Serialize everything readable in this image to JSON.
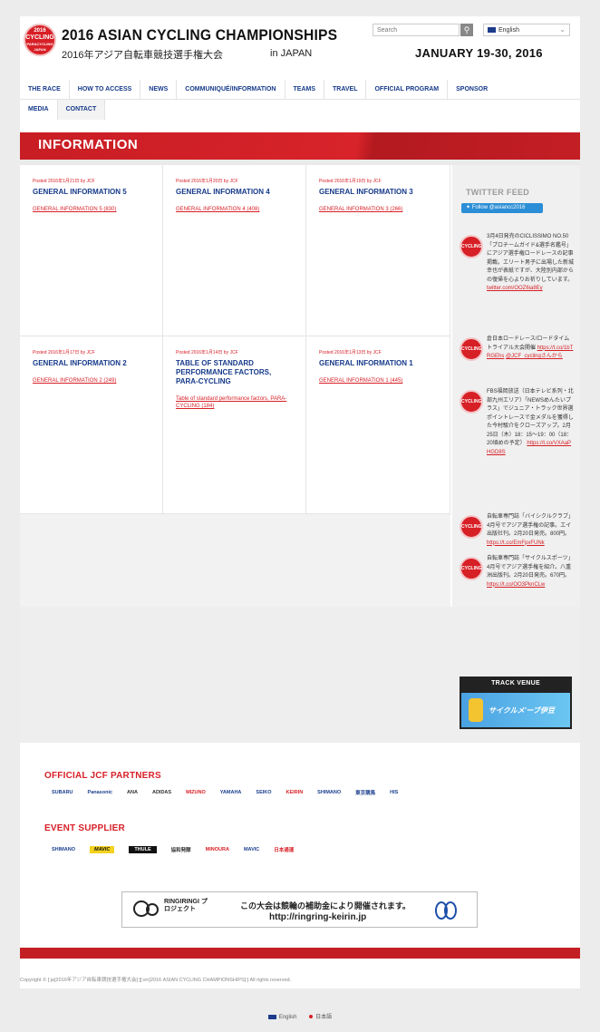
{
  "header": {
    "logo_lines": [
      "2016",
      "ASIAN",
      "CYCLING",
      "PARACYCLING",
      "JAPAN"
    ],
    "title_en": "2016 ASIAN CYCLING CHAMPIONSHIPS",
    "title_jp": "2016年アジア自転車競技選手権大会",
    "title_loc": "in JAPAN",
    "search_placeholder": "Search",
    "search_icon": "search-icon",
    "language": "English",
    "dates": "JANUARY 19-30, 2016"
  },
  "nav": {
    "row1": [
      "THE RACE",
      "HOW TO ACCESS",
      "NEWS",
      "COMMUNIQUÉ/INFORMATION",
      "TEAMS",
      "TRAVEL",
      "OFFICIAL PROGRAM",
      "SPONSOR"
    ],
    "row2": [
      "MEDIA",
      "CONTACT"
    ]
  },
  "banner": {
    "title": "INFORMATION"
  },
  "posts": [
    {
      "meta": "Posted 2016年1月21日 by JCF",
      "title": "GENERAL INFORMATION 5",
      "link": "GENERAL INFORMATION 5 (830)"
    },
    {
      "meta": "Posted 2016年1月20日 by JCF",
      "title": "GENERAL INFORMATION 4",
      "link": "GENERAL INFORMATION 4 (408)"
    },
    {
      "meta": "Posted 2016年1月19日 by JCF",
      "title": "GENERAL INFORMATION 3",
      "link": "GENERAL INFORMATION 3 (266)"
    },
    {
      "meta": "Posted 2016年1月17日 by JCF",
      "title": "GENERAL INFORMATION 2",
      "link": "GENERAL INFORMATION 2 (249)"
    },
    {
      "meta": "Posted 2016年1月14日 by JCF",
      "title": "TABLE OF STANDARD PERFORMANCE FACTORS, PARA-CYCLING",
      "link": "Table of standard performance factors, PARA-CYCLING (184)"
    },
    {
      "meta": "Posted 2016年1月13日 by JCF",
      "title": "GENERAL INFORMATION 1",
      "link": "GENERAL INFORMATION 1 (445)"
    }
  ],
  "twitter": {
    "heading": "TWITTER FEED",
    "follow": "Follow @asiancc2016",
    "avatar_text": "CYCLING",
    "tweets": [
      {
        "text": "3月4日発売のCICLISSIMO NO.50「プロチームガイド&選手名鑑号」にアジア選手権ロードレースの記事掲載。エリート男子に出場した新城幸也が表紙ですが、大陸別内部からの復帰を心よりお祈りしています。",
        "link": "twitter.com/OOZ6ia8Ey"
      },
      {
        "text": "倉日本ロードレース/ロードタイムトライアル大会開催",
        "link": "https://t.co/1bTRGEhs",
        "extra": "@JCF_cyclingさんから"
      },
      {
        "text": "FBS福岡放送（日本テレビ系列・北部九州エリア）「NEWSめんたいプラス」でジュニア・トラック世界選ポイントレースで金メダルを獲得した今村駿介をクローズアップ。2月25日（木）18：15〜19：00（18：20頃めの予定）",
        "link": "https://t.co/VXAaPHGD8S"
      },
      {
        "text": "自転車専門誌「バイシクルクラブ」4月号でアジア選手権の記事。エイ出版社刊。2月20日発売。800円。",
        "link": "https://t.co/EmFpxFUNk"
      },
      {
        "text": "自転車専門誌「サイクルスポーツ」4月号でアジア選手権を紹介。八重洲出版刊。2月20日発売。670円。",
        "link": "https://t.co/OO3PknCLw"
      }
    ]
  },
  "track_venue": {
    "label": "TRACK VENUE",
    "image_text": "サイクルメ'ーブ伊豆"
  },
  "partners": {
    "heading": "OFFICIAL JCF PARTNERS",
    "logos": [
      "SUBARU",
      "Panasonic",
      "ANA",
      "ADIDAS",
      "MIZUNO",
      "YAMAHA",
      "SEIKO",
      "KEIRIN",
      "SHIMANO",
      "東京競馬",
      "HIS"
    ]
  },
  "suppliers": {
    "heading": "EVENT SUPPLIER",
    "logos": [
      "SHIMANO",
      "MAVIC",
      "THULE",
      "協和発酵",
      "MINOURA",
      "MAVIC",
      "日本通運"
    ]
  },
  "ringring": {
    "name": "RINGIRINGI プロジェクト",
    "text": "この大会は競輪の補助金により開催されます。",
    "url": "http://ringring-keirin.jp"
  },
  "footer": {
    "copyright": "Copyright © [:ja]2016年アジア自転車競技選手権大会[:][:en]2016 ASIAN CYCLING CHAMPIONSHIPS[:] All rights reserved.",
    "langs": [
      "English",
      "日本語"
    ]
  }
}
